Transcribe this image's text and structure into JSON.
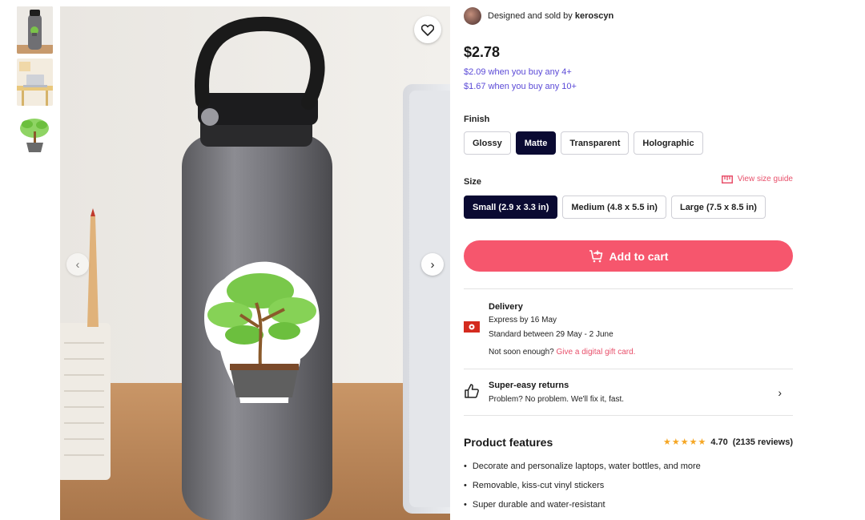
{
  "product": {
    "designer_prefix": "Designed and sold by",
    "designer_name": "keroscyn",
    "price": "$2.78",
    "tier_1": "$2.09 when you buy any 4+",
    "tier_2": "$1.67 when you buy any 10+"
  },
  "gallery": {
    "thumbnails": [
      {
        "name": "bottle-thumbnail",
        "icon": "bottle-sticker"
      },
      {
        "name": "laptop-thumbnail",
        "icon": "desk-laptop"
      },
      {
        "name": "sticker-thumbnail",
        "icon": "bonsai-sticker"
      }
    ],
    "favorite_icon": "heart-icon",
    "prev_icon": "‹",
    "next_icon": "›"
  },
  "finish": {
    "label": "Finish",
    "options": [
      "Glossy",
      "Matte",
      "Transparent",
      "Holographic"
    ],
    "selected": "Matte"
  },
  "size": {
    "label": "Size",
    "guide_label": "View size guide",
    "options": [
      "Small (2.9 x 3.3 in)",
      "Medium (4.8 x 5.5 in)",
      "Large (7.5 x 8.5 in)"
    ],
    "selected": "Small (2.9 x 3.3 in)"
  },
  "cart": {
    "label": "Add to cart"
  },
  "delivery": {
    "title": "Delivery",
    "express": "Express by 16 May",
    "standard": "Standard between 29 May - 2 June",
    "not_soon": "Not soon enough?",
    "gift_link": "Give a digital gift card."
  },
  "returns": {
    "title": "Super-easy returns",
    "subtitle": "Problem? No problem. We'll fix it, fast.",
    "chevron": "›"
  },
  "features": {
    "title": "Product features",
    "rating": "4.70",
    "reviews": "(2135 reviews)",
    "stars": 5,
    "items": [
      "Decorate and personalize laptops, water bottles, and more",
      "Removable, kiss-cut vinyl stickers",
      "Super durable and water-resistant"
    ]
  },
  "colors": {
    "accent_pink": "#f6566d",
    "link_pink": "#e8506b",
    "tier_purple": "#5b4ad7",
    "selected_navy": "#0a0a32",
    "star_gold": "#f5a623"
  }
}
